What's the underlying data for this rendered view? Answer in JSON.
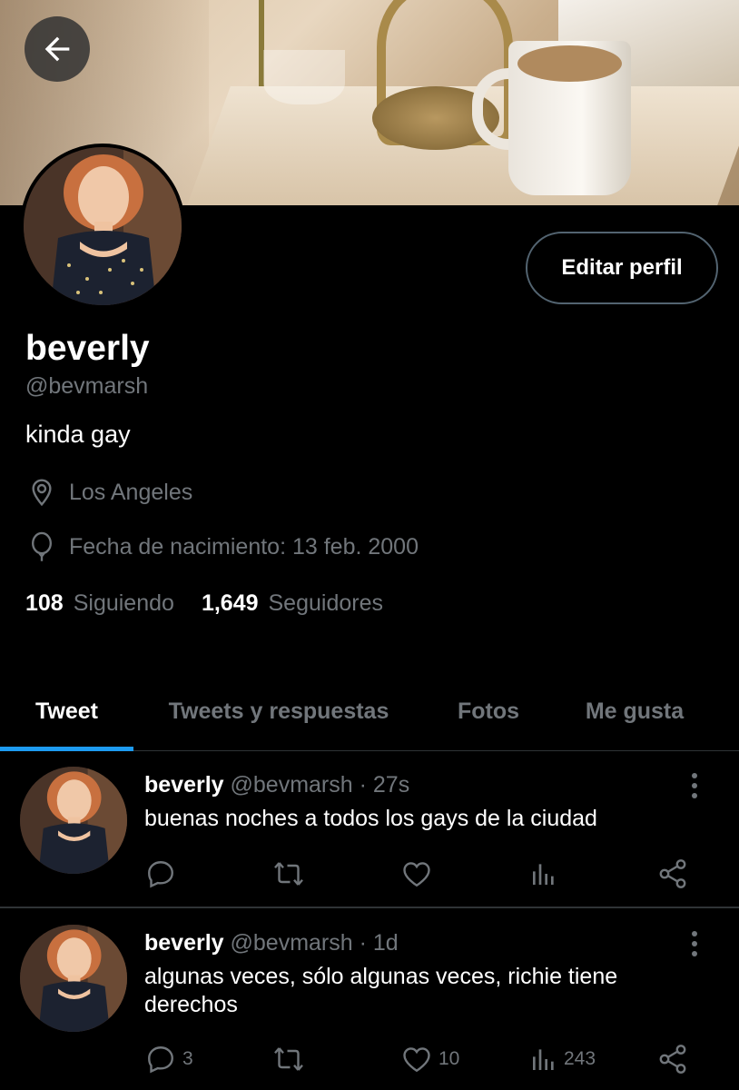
{
  "profile": {
    "name": "beverly",
    "handle": "@bevmarsh",
    "bio": "kinda gay",
    "location": "Los Angeles",
    "birthday": "Fecha de nacimiento: 13 feb. 2000",
    "following_count": "108",
    "following_label": "Siguiendo",
    "followers_count": "1,649",
    "followers_label": "Seguidores",
    "edit_label": "Editar perfil"
  },
  "tabs": [
    {
      "label": "Tweet",
      "active": true
    },
    {
      "label": "Tweets y respuestas",
      "active": false
    },
    {
      "label": "Fotos",
      "active": false
    },
    {
      "label": "Me gusta",
      "active": false
    }
  ],
  "tweets": [
    {
      "name": "beverly",
      "handle": "@bevmarsh",
      "time": "· 27s",
      "text": "buenas noches a todos los gays de la ciudad",
      "replies": "",
      "retweets": "",
      "likes": "",
      "views": ""
    },
    {
      "name": "beverly",
      "handle": "@bevmarsh",
      "time": "· 1d",
      "text": "algunas veces, sólo algunas veces, richie tiene derechos",
      "replies": "3",
      "retweets": "",
      "likes": "10",
      "views": "243"
    }
  ],
  "colors": {
    "background": "#000000",
    "secondary_text": "#71767b",
    "accent": "#1d9bf0",
    "border": "#2f3336"
  }
}
